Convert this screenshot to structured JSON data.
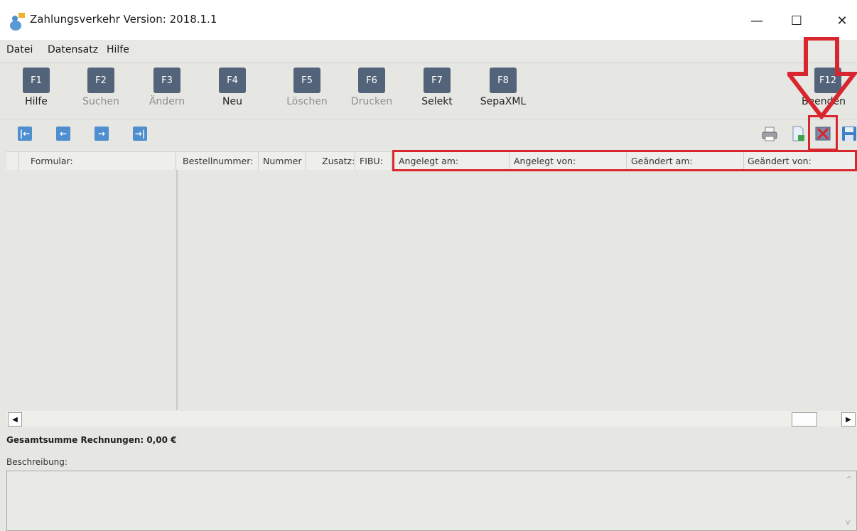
{
  "window": {
    "title": "Zahlungsverkehr Version: 2018.1.1",
    "minimize": "—",
    "maximize": "☐",
    "close": "✕"
  },
  "menu": [
    "Datei",
    "Datensatz",
    "Hilfe"
  ],
  "fkeys": [
    {
      "key": "F1",
      "label": "Hilfe",
      "enabled": true
    },
    {
      "key": "F2",
      "label": "Suchen",
      "enabled": false
    },
    {
      "key": "F3",
      "label": "Ändern",
      "enabled": false
    },
    {
      "key": "F4",
      "label": "Neu",
      "enabled": true
    },
    {
      "key": "F5",
      "label": "Löschen",
      "enabled": false
    },
    {
      "key": "F6",
      "label": "Drucken",
      "enabled": false
    },
    {
      "key": "F7",
      "label": "Selekt",
      "enabled": true
    },
    {
      "key": "F8",
      "label": "SepaXML",
      "enabled": true
    },
    {
      "key": "F12",
      "label": "Beenden",
      "enabled": true
    }
  ],
  "nav": {
    "first": "|←",
    "prev": "←",
    "next": "→",
    "last": "→|"
  },
  "toolbar_icons": [
    "print-icon",
    "export-document-icon",
    "delete-record-icon",
    "save-icon"
  ],
  "grid": {
    "columns": [
      "Formular:",
      "Bestellnummer:",
      "Nummer",
      "Zusatz:",
      "FIBU:",
      "Angelegt am:",
      "Angelegt von:",
      "Geändert am:",
      "Geändert von:"
    ],
    "rows": []
  },
  "scroll": {
    "left": "◀",
    "right": "▶"
  },
  "footer": {
    "total": "Gesamtsumme Rechnungen: 0,00 €",
    "description_label": "Beschreibung:",
    "description_value": "",
    "scroll_up": "^",
    "scroll_down": "v"
  },
  "colors": {
    "fkey_bg": "#53637a",
    "nav_bg": "#4f8fcf",
    "annotation": "#d9262e"
  }
}
